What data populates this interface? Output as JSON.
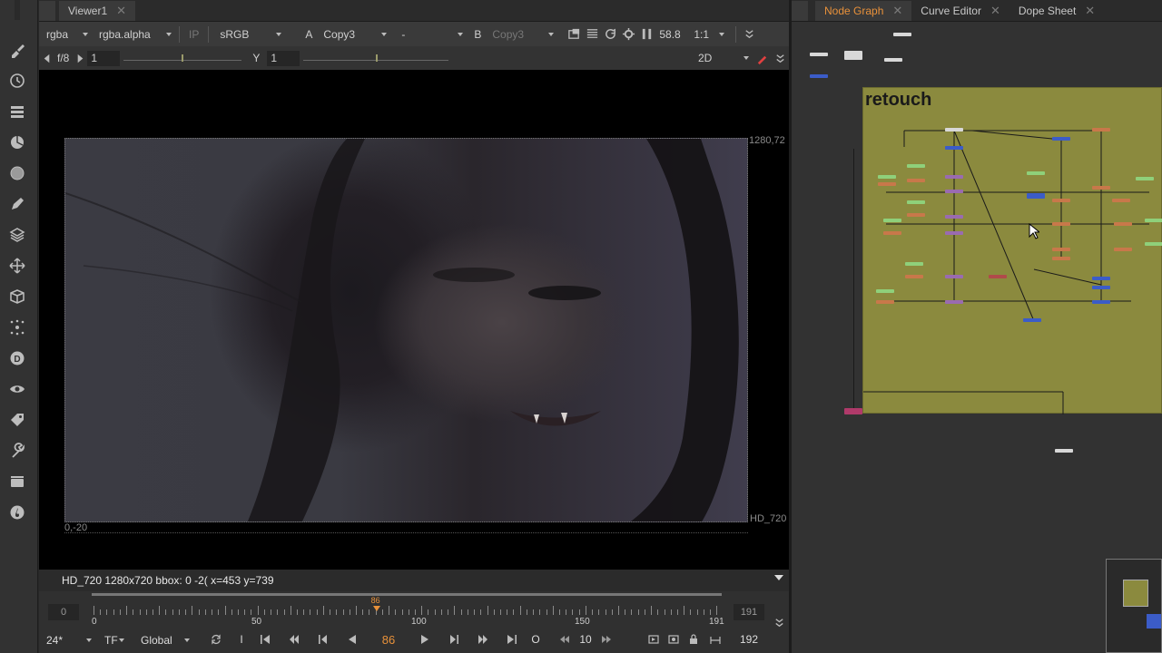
{
  "toolbar": {
    "icons": [
      "paint-brush-icon",
      "clock-icon",
      "channels-icon",
      "color-icon",
      "circle-icon",
      "pen-icon",
      "layers-icon",
      "transform-icon",
      "3d-box-icon",
      "particles-icon",
      "deep-icon",
      "views-icon",
      "metadata-icon",
      "toolsets-icon",
      "other-icon",
      "furnace-icon"
    ]
  },
  "viewer": {
    "tab_label": "Viewer1",
    "channels": "rgba",
    "alpha": "rgba.alpha",
    "ip_label": "IP",
    "colorspace": "sRGB",
    "a_label": "A",
    "a_input": "Copy3",
    "wipe_mode": "-",
    "b_label": "B",
    "b_input": "Copy3",
    "gain_value": "58.8",
    "zoom": "1:1",
    "fstop": "f/8",
    "gain_field": "1",
    "y_label": "Y",
    "gamma_field": "1",
    "view_mode": "2D",
    "corner_tr": "1280,72",
    "corner_bl": "0,-20",
    "format_label": "HD_720",
    "status_text": "HD_720 1280x720  bbox: 0 -2(  x=453 y=739"
  },
  "timeline": {
    "start": "0",
    "end": "191",
    "ticks": [
      "0",
      "50",
      "100",
      "150",
      "191"
    ],
    "current_frame": "86",
    "fps": "24*",
    "tf": "TF",
    "scope": "Global",
    "increment": "10",
    "end_frame": "192",
    "in_label": "I",
    "out_label": "O"
  },
  "right_panel": {
    "tabs": [
      "Node Graph",
      "Curve Editor",
      "Dope Sheet"
    ],
    "backdrop_label": "retouch"
  },
  "colors": {
    "accent": "#e8913a",
    "backdrop": "#8b8a3e"
  }
}
